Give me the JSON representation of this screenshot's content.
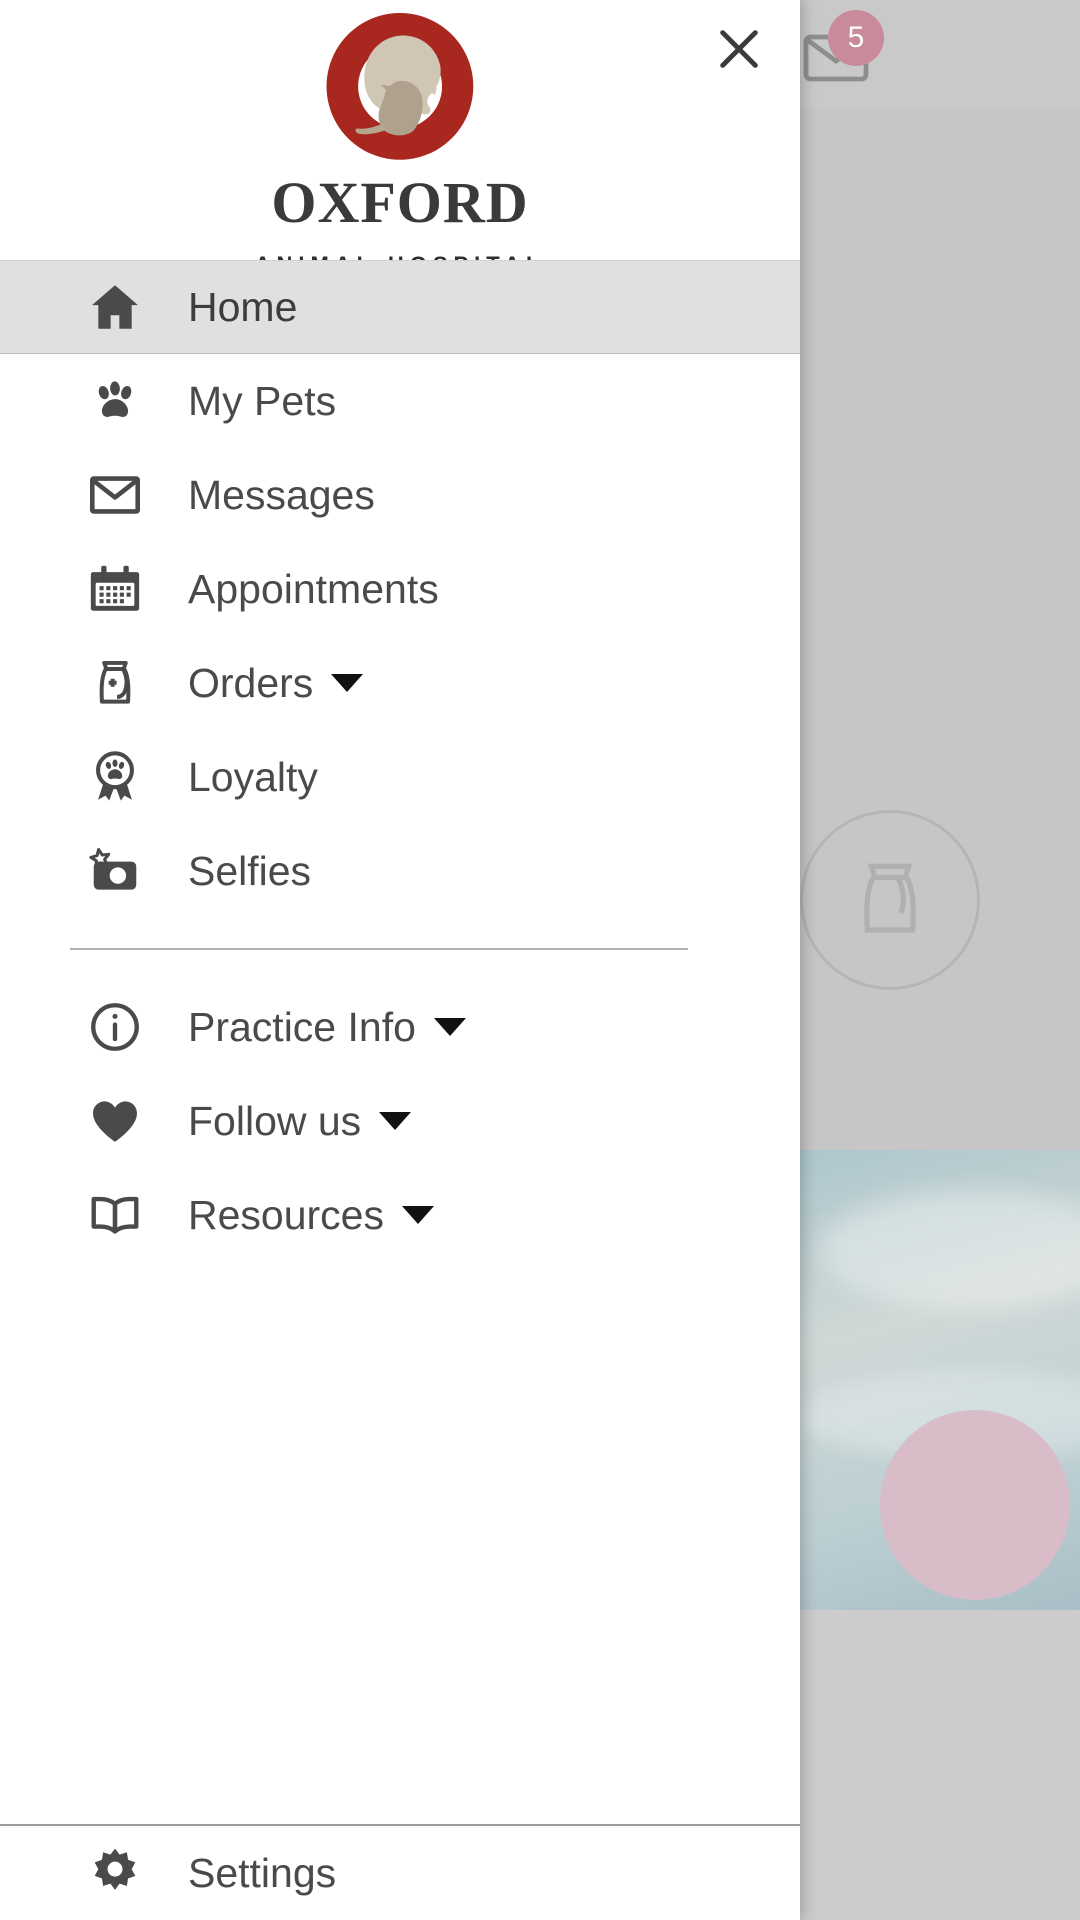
{
  "brand": {
    "logo_icon": "oxford-pet-logo",
    "name": "OXFORD",
    "tagline": "ANIMAL HOSPITAL",
    "accent_red": "#9c1f1f",
    "logo_ring_color": "#a82820",
    "logo_dog_color": "#cfc6b4",
    "logo_cat_color": "#b0a18f"
  },
  "header": {
    "close_icon": "close-icon",
    "close_label": "Close"
  },
  "background": {
    "mail_icon": "mail-icon",
    "badge_count": "5",
    "badge_color": "#c98b99"
  },
  "nav": {
    "primary": [
      {
        "id": "home",
        "label": "Home",
        "icon": "home-icon",
        "selected": true,
        "expandable": false
      },
      {
        "id": "my-pets",
        "label": "My Pets",
        "icon": "paw-icon",
        "selected": false,
        "expandable": false
      },
      {
        "id": "messages",
        "label": "Messages",
        "icon": "mail-icon",
        "selected": false,
        "expandable": false
      },
      {
        "id": "appointments",
        "label": "Appointments",
        "icon": "calendar-icon",
        "selected": false,
        "expandable": false
      },
      {
        "id": "orders",
        "label": "Orders",
        "icon": "food-bag-icon",
        "selected": false,
        "expandable": true
      },
      {
        "id": "loyalty",
        "label": "Loyalty",
        "icon": "award-paw-icon",
        "selected": false,
        "expandable": false
      },
      {
        "id": "selfies",
        "label": "Selfies",
        "icon": "camera-star-icon",
        "selected": false,
        "expandable": false
      }
    ],
    "secondary": [
      {
        "id": "practice-info",
        "label": "Practice Info",
        "icon": "info-circle-icon",
        "selected": false,
        "expandable": true
      },
      {
        "id": "follow-us",
        "label": "Follow us",
        "icon": "heart-icon",
        "selected": false,
        "expandable": true
      },
      {
        "id": "resources",
        "label": "Resources",
        "icon": "book-icon",
        "selected": false,
        "expandable": true
      }
    ],
    "footer": [
      {
        "id": "settings",
        "label": "Settings",
        "icon": "gear-icon",
        "selected": false,
        "expandable": false
      }
    ]
  }
}
